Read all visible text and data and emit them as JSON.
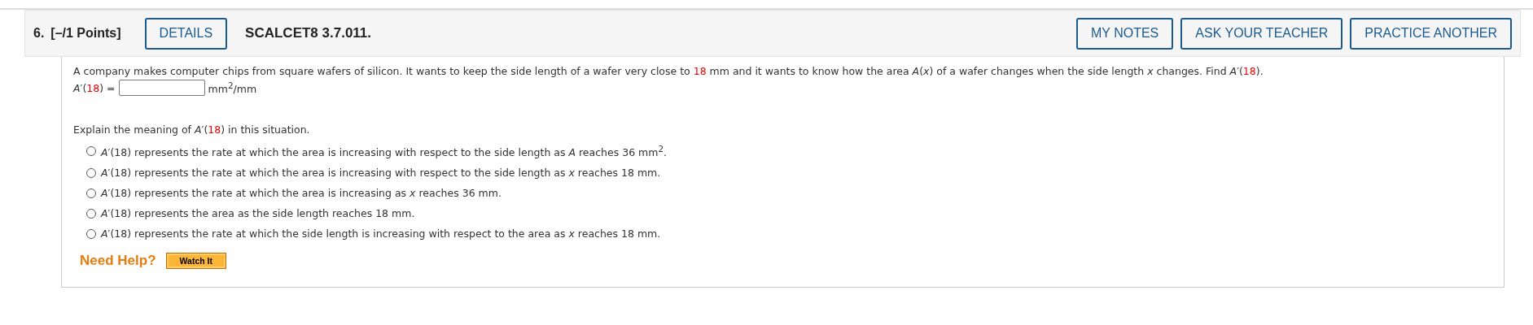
{
  "question": {
    "number": "6.",
    "points": "[–/1 Points]",
    "details_button": "DETAILS",
    "code": "SCALCET8 3.7.011.",
    "actions": [
      "MY NOTES",
      "ASK YOUR TEACHER",
      "PRACTICE ANOTHER"
    ]
  },
  "prompt": [
    {
      "kind": "plain",
      "text": "A company makes computer chips from square wafers of silicon. It wants to keep the side length of a wafer very close to "
    },
    {
      "kind": "red",
      "text": "18"
    },
    {
      "kind": "plain",
      "text": " mm and it wants to know how the area "
    },
    {
      "kind": "italic",
      "text": "A"
    },
    {
      "kind": "plain",
      "text": "("
    },
    {
      "kind": "italic",
      "text": "x"
    },
    {
      "kind": "plain",
      "text": ") of a wafer changes when the side length "
    },
    {
      "kind": "italic",
      "text": "x"
    },
    {
      "kind": "plain",
      "text": " changes. Find "
    },
    {
      "kind": "italic",
      "text": "A"
    },
    {
      "kind": "plain",
      "text": "′("
    },
    {
      "kind": "red",
      "text": "18"
    },
    {
      "kind": "plain",
      "text": ")."
    }
  ],
  "answer": {
    "label": [
      {
        "kind": "italic",
        "text": "A"
      },
      {
        "kind": "plain",
        "text": "′("
      },
      {
        "kind": "red",
        "text": "18"
      },
      {
        "kind": "plain",
        "text": ") ="
      }
    ],
    "unit": "mm$^{2}$/mm"
  },
  "explain": [
    {
      "kind": "plain",
      "text": "Explain the meaning of "
    },
    {
      "kind": "italic",
      "text": "A"
    },
    {
      "kind": "plain",
      "text": "′("
    },
    {
      "kind": "red",
      "text": "18"
    },
    {
      "kind": "plain",
      "text": ") in this situation."
    }
  ],
  "options": [
    {
      "selected": false,
      "text": "*A*′(18) represents the rate at which the area is increasing with respect to the side length as *A* reaches 36 mm$^{2}$."
    },
    {
      "selected": false,
      "text": "*A*′(18) represents the rate at which the area is increasing with respect to the side length as *x* reaches 18 mm."
    },
    {
      "selected": false,
      "text": "*A*′(18) represents the rate at which the area is increasing as *x* reaches 36 mm."
    },
    {
      "selected": false,
      "text": "*A*′(18) represents the area as the side length reaches 18 mm."
    },
    {
      "selected": false,
      "text": "*A*′(18) represents the rate at which the side length is increasing with respect to the area as *x* reaches 18 mm."
    }
  ],
  "help": {
    "label": "Need Help?",
    "button": "Watch It"
  }
}
